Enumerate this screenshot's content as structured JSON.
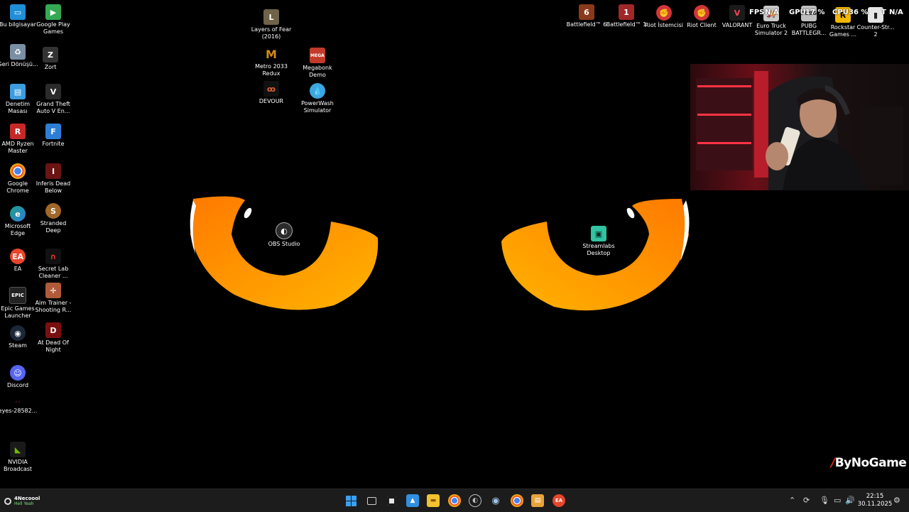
{
  "desktop": {
    "left_col1": [
      {
        "label": "Bu bilgisayar",
        "icon": "computer-icon",
        "color": "#1f8fd8"
      },
      {
        "label": "Geri Dönüşü...",
        "icon": "recycle-bin-icon",
        "color": "#7a8fa3"
      },
      {
        "label": "Denetim Masası",
        "icon": "control-panel-icon",
        "color": "#3d9be0"
      },
      {
        "label": "AMD Ryzen Master",
        "icon": "amd-icon",
        "color": "#c62828"
      },
      {
        "label": "Google Chrome",
        "icon": "chrome-icon",
        "color": "#2e9d4a"
      },
      {
        "label": "Microsoft Edge",
        "icon": "edge-icon",
        "color": "#1da081"
      },
      {
        "label": "EA",
        "icon": "ea-icon",
        "color": "#e8452b"
      },
      {
        "label": "Epic Games Launcher",
        "icon": "epic-icon",
        "color": "#222222"
      },
      {
        "label": "Steam",
        "icon": "steam-icon",
        "color": "#1b2838"
      },
      {
        "label": "Discord",
        "icon": "discord-icon",
        "color": "#5865f2"
      },
      {
        "label": "eyes-28582...",
        "icon": "image-file-icon",
        "color": "#000000"
      },
      {
        "label": "NVIDIA Broadcast",
        "icon": "nvidia-icon",
        "color": "#1a1a1a"
      }
    ],
    "left_col2": [
      {
        "label": "Google Play Games",
        "icon": "play-games-icon",
        "color": "#34a853"
      },
      {
        "label": "Zort",
        "icon": "zort-icon",
        "color": "#333333"
      },
      {
        "label": "Grand Theft Auto V En...",
        "icon": "gta-icon",
        "color": "#2b2b2b"
      },
      {
        "label": "Fortnite",
        "icon": "fortnite-icon",
        "color": "#2d7fd6"
      },
      {
        "label": "Inferis Dead Below",
        "icon": "inferis-icon",
        "color": "#6b1414"
      },
      {
        "label": "Stranded Deep",
        "icon": "stranded-icon",
        "color": "#a0672a"
      },
      {
        "label": "Secret Lab Cleaner ...",
        "icon": "secret-lab-icon",
        "color": "#8b1a1a"
      },
      {
        "label": "Aim Trainer - Shooting R...",
        "icon": "aim-trainer-icon",
        "color": "#b05a3a"
      },
      {
        "label": "At Dead Of Night",
        "icon": "dead-of-night-icon",
        "color": "#7a0f0f"
      }
    ],
    "mid": [
      {
        "label": "Layers of Fear (2016)",
        "icon": "layers-of-fear-icon",
        "color": "#6e6248"
      },
      {
        "label": "Metro 2033 Redux",
        "icon": "metro-icon",
        "color": "#d48a14"
      },
      {
        "label": "Megabonk Demo",
        "icon": "megabonk-icon",
        "color": "#c23b2a"
      },
      {
        "label": "DEVOUR",
        "icon": "devour-icon",
        "color": "#b34a1c"
      },
      {
        "label": "PowerWash Simulator",
        "icon": "powerwash-icon",
        "color": "#3aa7e0"
      }
    ],
    "center": [
      {
        "label": "OBS Studio",
        "icon": "obs-icon",
        "color": "#2b2b2b"
      },
      {
        "label": "Streamlabs Desktop",
        "icon": "streamlabs-icon",
        "color": "#31c3a2"
      }
    ],
    "top_right": [
      {
        "label": "Battlefield™ 6",
        "icon": "battlefield6-icon",
        "color": "#8a3a1a"
      },
      {
        "label": "Battlefield™ 1",
        "icon": "battlefield1-icon",
        "color": "#a02828"
      },
      {
        "label": "Riot İstemcisi",
        "icon": "riot-client-icon",
        "color": "#d13639"
      },
      {
        "label": "Riot Client",
        "icon": "riot-client-2-icon",
        "color": "#d13639"
      },
      {
        "label": "VALORANT",
        "icon": "valorant-icon",
        "color": "#fa4454"
      },
      {
        "label": "Euro Truck Simulator 2",
        "icon": "ets2-icon",
        "color": "#c9c9c9"
      },
      {
        "label": "PUBG BATTLEGR...",
        "icon": "pubg-icon",
        "color": "#bfbfbf"
      },
      {
        "label": "Rockstar Games ...",
        "icon": "rockstar-icon",
        "color": "#f2b705"
      },
      {
        "label": "Counter-Str... 2",
        "icon": "cs2-icon",
        "color": "#e6e6e6"
      }
    ]
  },
  "overlay": {
    "fps_label": "FPS",
    "fps_value": "N/A",
    "gpu_label": "GPU",
    "gpu_value": "17 %",
    "cpu_label": "CPU",
    "cpu_value": "36 %",
    "t_label": "T",
    "t_value": "N/A"
  },
  "brand": {
    "name": "ByNoGame"
  },
  "taskbar": {
    "user_name": "4Necoool",
    "user_status": "Hell Yeah",
    "apps": [
      {
        "icon": "windows-start-icon",
        "color": "#3aa0f2"
      },
      {
        "icon": "task-view-icon",
        "color": "#cfcfcf"
      },
      {
        "icon": "snipping-tool-icon",
        "color": "#e6e6e6"
      },
      {
        "icon": "photos-icon",
        "color": "#2f8fe0"
      },
      {
        "icon": "file-explorer-icon",
        "color": "#f2c230"
      },
      {
        "icon": "chrome-icon",
        "color": "#2e9d4a"
      },
      {
        "icon": "obs-icon",
        "color": "#bdbdbd"
      },
      {
        "icon": "steam-icon",
        "color": "#2a475e"
      },
      {
        "icon": "chrome-beta-icon",
        "color": "#2e9d4a"
      },
      {
        "icon": "notepad-icon",
        "color": "#e8a33a"
      },
      {
        "icon": "ea-icon",
        "color": "#e8452b"
      }
    ],
    "time": "22:15",
    "date": "30.11.2025"
  }
}
